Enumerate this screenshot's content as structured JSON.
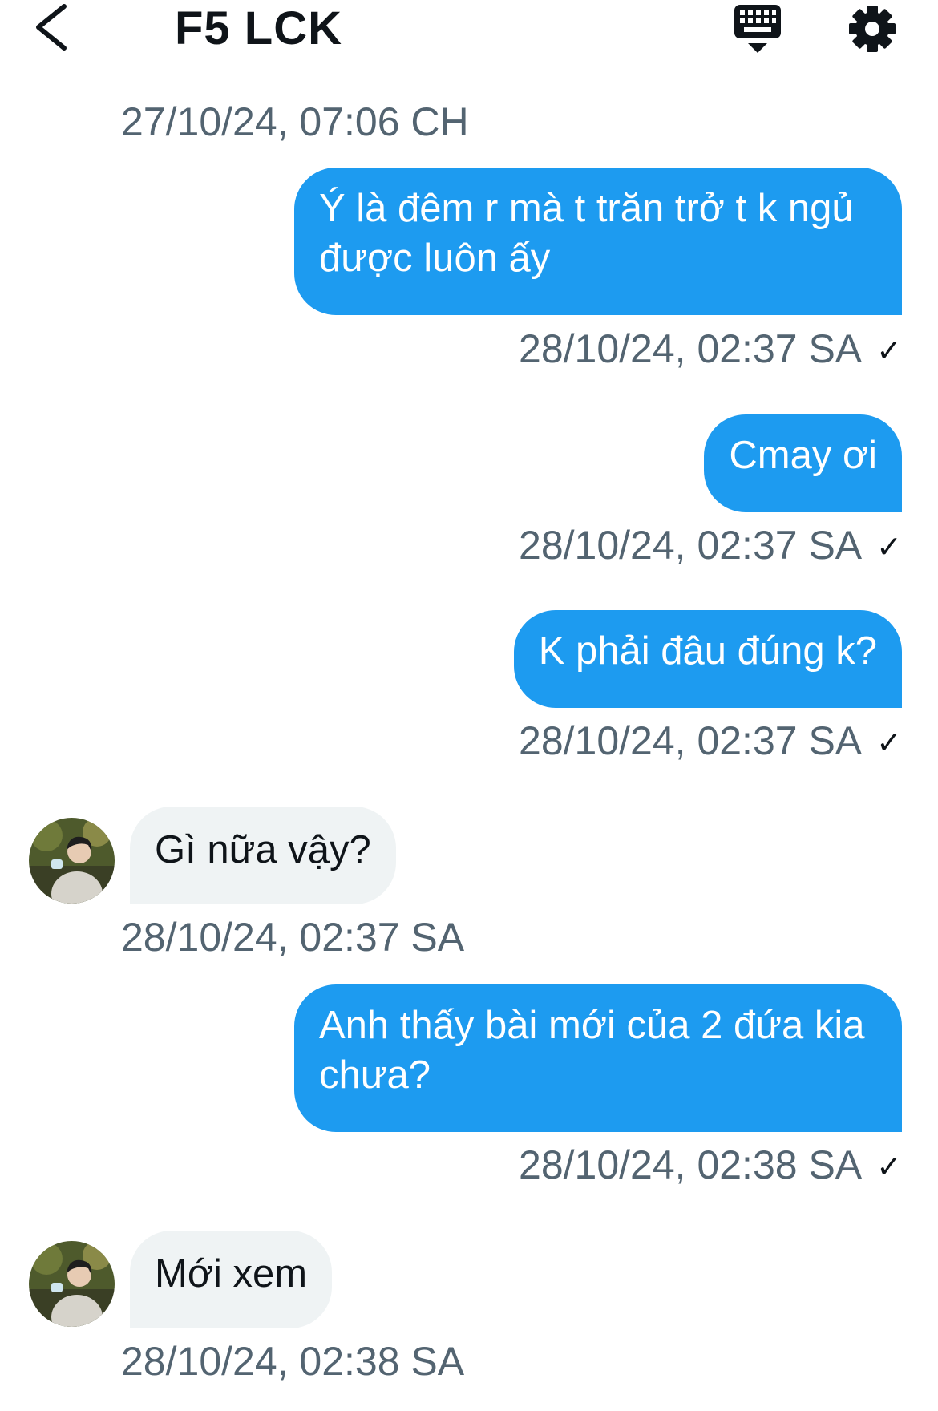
{
  "header": {
    "title": "F5 LCK",
    "back_icon": "chevron-left-icon",
    "keyboard_icon": "keyboard-icon",
    "settings_icon": "gear-icon"
  },
  "colors": {
    "outgoing_bubble": "#1d9bf0",
    "incoming_bubble": "#eff3f4",
    "timestamp": "#536471"
  },
  "messages": [
    {
      "direction": "timestamp",
      "time": "27/10/24, 07:06 CH"
    },
    {
      "direction": "out",
      "text": "Ý là đêm r mà t trăn trở t k ngủ được luôn ấy",
      "time": "28/10/24, 02:37 SA",
      "status": "✓"
    },
    {
      "direction": "out",
      "text": "Cmay ơi",
      "time": "28/10/24, 02:37 SA",
      "status": "✓"
    },
    {
      "direction": "out",
      "text": "K phải đâu đúng k?",
      "time": "28/10/24, 02:37 SA",
      "status": "✓"
    },
    {
      "direction": "in",
      "text": "Gì nữa vậy?",
      "time": "28/10/24, 02:37 SA"
    },
    {
      "direction": "out",
      "text": "Anh thấy bài mới của 2 đứa kia chưa?",
      "time": "28/10/24, 02:38 SA",
      "status": "✓"
    },
    {
      "direction": "in",
      "text": "Mới xem",
      "time": "28/10/24, 02:38 SA"
    }
  ]
}
